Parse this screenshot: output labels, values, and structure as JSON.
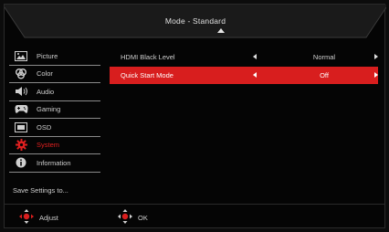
{
  "header": {
    "title": "Mode - Standard"
  },
  "sidebar": {
    "items": [
      {
        "label": "Picture",
        "icon": "picture-icon"
      },
      {
        "label": "Color",
        "icon": "color-palette-icon"
      },
      {
        "label": "Audio",
        "icon": "speaker-icon"
      },
      {
        "label": "Gaming",
        "icon": "gamepad-icon"
      },
      {
        "label": "OSD",
        "icon": "osd-icon"
      },
      {
        "label": "System",
        "icon": "gear-icon",
        "active": true
      },
      {
        "label": "Information",
        "icon": "info-icon"
      }
    ],
    "save_label": "Save Settings to..."
  },
  "settings": {
    "rows": [
      {
        "label": "HDMI Black Level",
        "value": "Normal"
      },
      {
        "label": "Quick Start Mode",
        "value": "Off",
        "active": true
      }
    ]
  },
  "footer": {
    "adjust_label": "Adjust",
    "ok_label": "OK"
  },
  "colors": {
    "accent": "#d81e1e",
    "background": "#050505"
  }
}
